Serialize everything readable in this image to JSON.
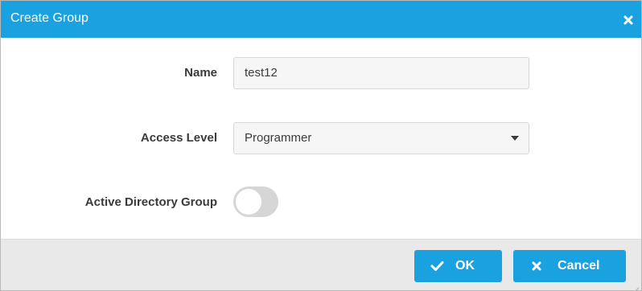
{
  "dialog": {
    "title": "Create Group",
    "close_icon": "close-icon"
  },
  "form": {
    "name": {
      "label": "Name",
      "value": "test12"
    },
    "access_level": {
      "label": "Access Level",
      "selected": "Programmer",
      "icon": "caret-down-icon"
    },
    "active_directory_group": {
      "label": "Active Directory Group",
      "enabled": false
    }
  },
  "footer": {
    "ok_label": "OK",
    "ok_icon": "check-icon",
    "cancel_label": "Cancel",
    "cancel_icon": "close-icon"
  },
  "colors": {
    "accent": "#1aa1e0",
    "footer_bg": "#e9e9e9",
    "input_bg": "#f6f6f6",
    "toggle_off": "#d6d6d6"
  }
}
